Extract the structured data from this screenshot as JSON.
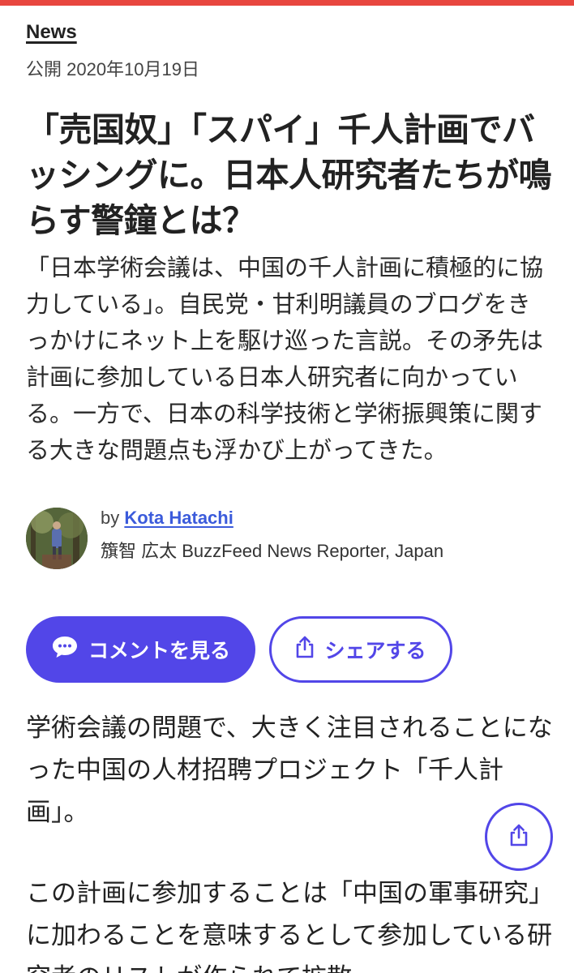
{
  "colors": {
    "accent": "#5246e8",
    "top_bar": "#e8463f",
    "link": "#3b5bdb"
  },
  "article": {
    "category": "News",
    "published": "公開 2020年10月19日",
    "headline": "「売国奴」「スパイ」千人計画でバッシングに。日本人研究者たちが鳴らす警鐘とは？",
    "dek": "「日本学術会議は、中国の千人計画に積極的に協力している」。自民党・甘利明議員のブログをきっかけにネット上を駆け巡った言説。その矛先は計画に参加している日本人研究者に向かっている。一方で、日本の科学技術と学術振興策に関する大きな問題点も浮かび上がってきた。",
    "byline": {
      "by": "by",
      "author_name": "Kota Hatachi",
      "author_title": "籏智 広太 BuzzFeed News Reporter, Japan"
    },
    "buttons": {
      "comments_label": "コメントを見る",
      "comments_icon": "speech-bubble-icon",
      "share_label": "シェアする",
      "share_icon": "share-icon"
    },
    "body": [
      "学術会議の問題で、大きく注目されることになった中国の人材招聘プロジェクト「千人計画」。",
      "この計画に参加することは「中国の軍事研究」に加わることを意味するとして参加している研究者のリストが作られて拡散"
    ],
    "floating_share_icon": "share-icon"
  }
}
